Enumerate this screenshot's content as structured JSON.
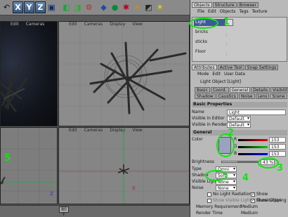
{
  "toolbar": {
    "axis_buttons": [
      "X",
      "Y",
      "Z"
    ],
    "icons": [
      "undo-icon",
      "axis-x-button",
      "axis-y-button",
      "axis-z-button",
      "coordinate-icon",
      "render-view-icon",
      "render-pic-icon",
      "render-settings-icon",
      "cube-icon",
      "nurbs-icon",
      "deformer-icon",
      "scene-icon",
      "camera-icon",
      "light-icon"
    ]
  },
  "viewports": {
    "menu": [
      "Edit",
      "Cameras",
      "Display",
      "View"
    ],
    "frame_value": "80 F"
  },
  "object_manager": {
    "tabs": [
      "Objects",
      "Structure",
      "Browser"
    ],
    "menu": [
      "File",
      "Edit",
      "Objects",
      "Tags",
      "Texture"
    ],
    "objects": [
      {
        "name": "Light",
        "selected": true
      },
      {
        "name": "bricks",
        "selected": false
      },
      {
        "name": "sticks",
        "selected": false
      },
      {
        "name": "Floor",
        "selected": false
      }
    ]
  },
  "attributes": {
    "tabs": [
      "Attributes",
      "Active Tool",
      "Snap Settings"
    ],
    "menu": [
      "Mode",
      "Edit",
      "User Data"
    ],
    "title": "Light Object [Light]",
    "subtabs_row1": [
      "Basic",
      "Coord.",
      "General",
      "Details",
      "Visibility"
    ],
    "subtabs_row2": [
      "Shadow",
      "Caustics",
      "Noise",
      "Lens",
      "Scene"
    ],
    "basic_header": "Basic Properties",
    "name_label": "Name",
    "name_value": "Light",
    "visible_editor_label": "Visible in Editor",
    "visible_editor_value": "Default",
    "visible_renderer_label": "Visible in Renderer",
    "visible_renderer_value": "Default",
    "general_header": "General",
    "color_label": "Color",
    "rgb_labels": [
      "R",
      "G",
      "B"
    ],
    "rgb_values": [
      "153",
      "153",
      "153"
    ],
    "brightness_label": "Brightness",
    "brightness_value": "43 %",
    "brightness_fraction": 0.43,
    "type_label": "Type",
    "type_value": "Omni",
    "shadow_label": "Shadow",
    "shadow_value": "Soft",
    "visible_light_label": "Visible Light",
    "visible_light_value": "None",
    "noise_label": "Noise",
    "noise_value": "None",
    "checks": [
      {
        "label": "No Light Radiation",
        "checked": false
      },
      {
        "label": "Show Illumination",
        "checked": true
      },
      {
        "label": "Show Visible Light",
        "checked": false
      },
      {
        "label": "Show Clipping",
        "checked": true
      }
    ],
    "memory_label": "Memory Requirement",
    "memory_value": "Medium",
    "render_time_label": "Render Time",
    "render_time_value": "Medium"
  },
  "annotations": [
    "1",
    "2",
    "3",
    "4",
    "5"
  ],
  "colors": {
    "annotation": "#14e214",
    "selection": "#3c5a9a"
  }
}
